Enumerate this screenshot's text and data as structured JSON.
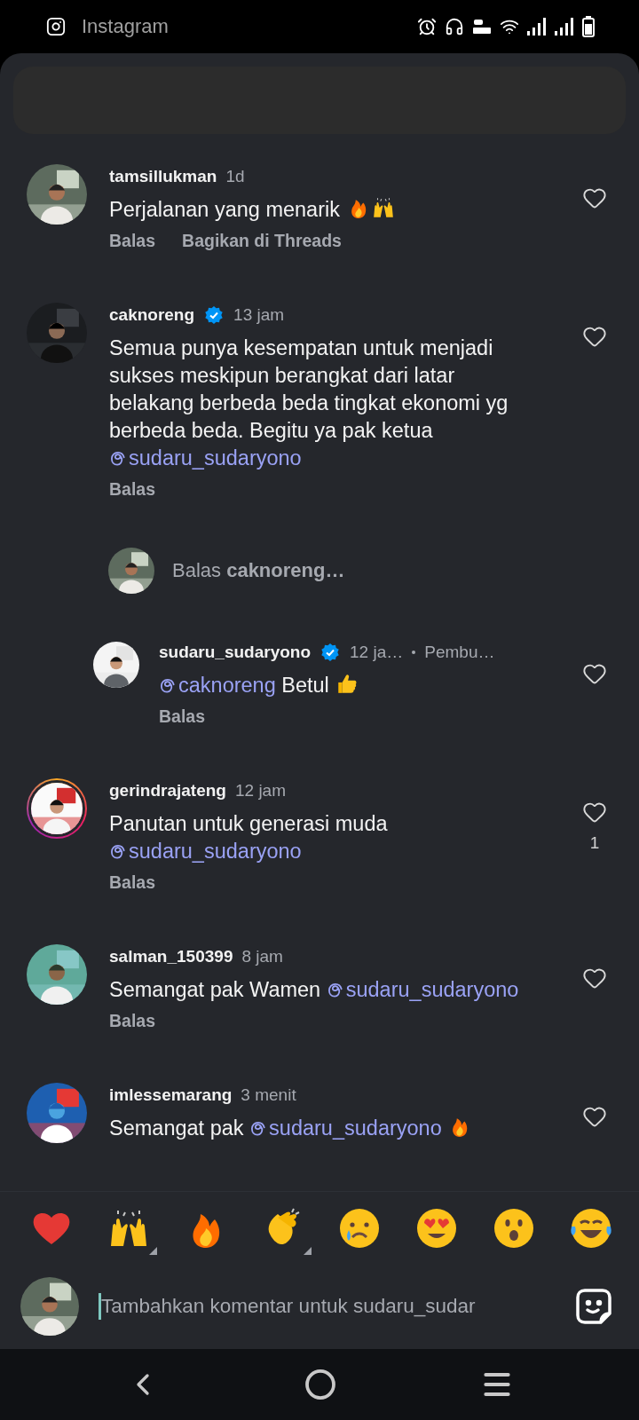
{
  "status_bar": {
    "app_name": "Instagram"
  },
  "comments": [
    {
      "username": "tamsillukman",
      "verified": false,
      "story_ring": false,
      "reply": false,
      "time": "1d",
      "text": [
        {
          "kind": "plain",
          "text": "Perjalanan yang menarik "
        },
        {
          "kind": "fire"
        },
        {
          "kind": "raised-hands"
        }
      ],
      "actions": [
        "Balas",
        "Bagikan di Threads"
      ]
    },
    {
      "username": "caknoreng",
      "verified": true,
      "story_ring": false,
      "reply": false,
      "time": "13 jam",
      "text": [
        {
          "kind": "plain",
          "text": "Semua punya kesempatan untuk menjadi sukses meskipun berangkat dari latar belakang berbeda beda tingkat ekonomi yg berbeda beda. Begitu ya pak ketua "
        },
        {
          "kind": "mention",
          "text": "sudaru_sudaryono"
        }
      ],
      "actions": [
        "Balas"
      ]
    },
    {
      "kind": "reply-prompt",
      "text": "Balas **caknoreng…**"
    },
    {
      "username": "sudaru_sudaryono",
      "verified": true,
      "story_ring": false,
      "reply": true,
      "time": "12 ja…",
      "meta": "Pembu…",
      "text": [
        {
          "kind": "mention",
          "text": "caknoreng"
        },
        {
          "kind": "plain",
          "text": " Betul "
        },
        {
          "kind": "thumbs-up"
        }
      ],
      "actions": [
        "Balas"
      ]
    },
    {
      "username": "gerindrajateng",
      "verified": false,
      "story_ring": true,
      "reply": false,
      "time": "12 jam",
      "likes": "1",
      "text": [
        {
          "kind": "plain",
          "text": "Panutan untuk generasi muda "
        },
        {
          "kind": "mention",
          "text": "sudaru_sudaryono"
        }
      ],
      "actions": [
        "Balas"
      ]
    },
    {
      "username": "salman_150399",
      "verified": false,
      "story_ring": false,
      "reply": false,
      "time": "8 jam",
      "text": [
        {
          "kind": "plain",
          "text": "Semangat pak Wamen "
        },
        {
          "kind": "mention",
          "text": "sudaru_sudaryono"
        }
      ],
      "actions": [
        "Balas"
      ]
    },
    {
      "username": "imlessemarang",
      "verified": false,
      "story_ring": false,
      "reply": false,
      "time": "3 menit",
      "text": [
        {
          "kind": "plain",
          "text": "Semangat pak "
        },
        {
          "kind": "mention",
          "text": "sudaru_sudaryono"
        },
        {
          "kind": "fire"
        }
      ]
    }
  ],
  "reactions": [
    {
      "kind": "heart",
      "variants": false
    },
    {
      "kind": "raised-hands",
      "variants": true
    },
    {
      "kind": "fire",
      "variants": false
    },
    {
      "kind": "clap",
      "variants": true
    },
    {
      "kind": "crying",
      "variants": false
    },
    {
      "kind": "heart-eyes",
      "variants": false
    },
    {
      "kind": "surprised",
      "variants": false
    },
    {
      "kind": "laughing",
      "variants": false
    }
  ],
  "composer": {
    "placeholder": "Tambahkan komentar untuk sudaru_sudar"
  }
}
